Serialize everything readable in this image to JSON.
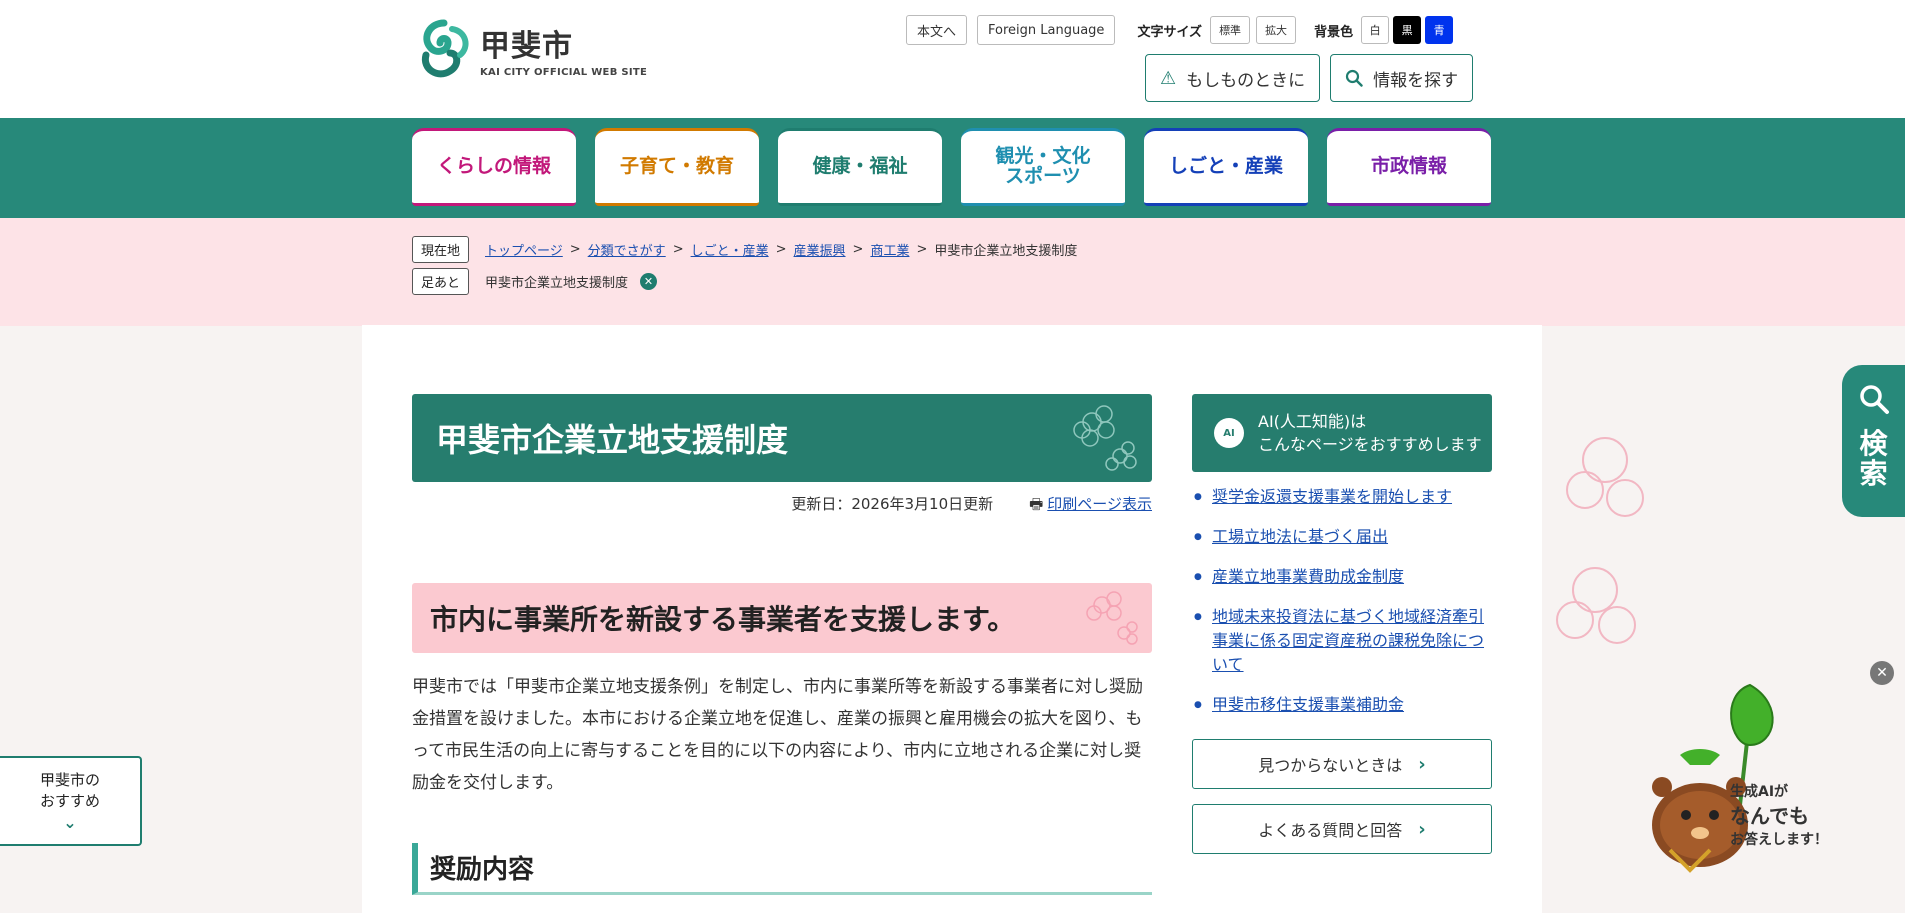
{
  "header": {
    "logo_title": "甲斐市",
    "logo_sub": "KAI CITY OFFICIAL WEB SITE",
    "skip_label": "本文へ",
    "foreign_label": "Foreign Language",
    "font_size_label": "文字サイズ",
    "font_standard": "標準",
    "font_large": "拡大",
    "bg_label": "背景色",
    "bg_white": "白",
    "bg_black": "黒",
    "bg_blue": "青",
    "emergency_label": "もしものときに",
    "search_label": "情報を探す"
  },
  "nav": {
    "items": [
      {
        "label": "くらしの情報",
        "color": "#c2187a"
      },
      {
        "label": "子育て・教育",
        "color": "#d17a00"
      },
      {
        "label": "健康・福祉",
        "color": "#1f7d6f"
      },
      {
        "label": "観光・文化\nスポーツ",
        "color": "#1f8fb0"
      },
      {
        "label": "しごと・産業",
        "color": "#1440b8"
      },
      {
        "label": "市政情報",
        "color": "#7a1fa8"
      }
    ]
  },
  "breadcrumb": {
    "current_label": "現在地",
    "links": [
      "トップページ",
      "分類でさがす",
      "しごと・産業",
      "産業振興",
      "商工業"
    ],
    "current": "甲斐市企業立地支援制度",
    "history_label": "足あと",
    "history_item": "甲斐市企業立地支援制度"
  },
  "main": {
    "title": "甲斐市企業立地支援制度",
    "updated": "更新日：2026年3月10日更新",
    "print_label": "印刷ページ表示",
    "h2": "市内に事業所を新設する事業者を支援します。",
    "body": "甲斐市では「甲斐市企業立地支援条例」を制定し、市内に事業所等を新設する事業者に対し奨励金措置を設けました。本市における企業立地を促進し、産業の振興と雇用機会の拡大を図り、もって市民生活の向上に寄与することを目的に以下の内容により、市内に立地される企業に対し奨励金を交付します。",
    "h3": "奨励内容"
  },
  "sidebar": {
    "ai_icon": "AI",
    "ai_line1": "AI(人工知能)は",
    "ai_line2": "こんなページをおすすめします",
    "links": [
      "奨学金返還支援事業を開始します",
      "工場立地法に基づく届出",
      "産業立地事業費助成金制度",
      "地域未来投資法に基づく地域経済牽引事業に係る固定資産税の課税免除について",
      "甲斐市移住支援事業補助金"
    ],
    "not_found": "見つからないときは",
    "faq": "よくある質問と回答"
  },
  "floating": {
    "search_word": "検索",
    "reco_line1": "甲斐市の",
    "reco_line2": "おすすめ",
    "mascot_l1": "生成AIが",
    "mascot_l2": "なんでも",
    "mascot_l3": "お答えします！"
  }
}
